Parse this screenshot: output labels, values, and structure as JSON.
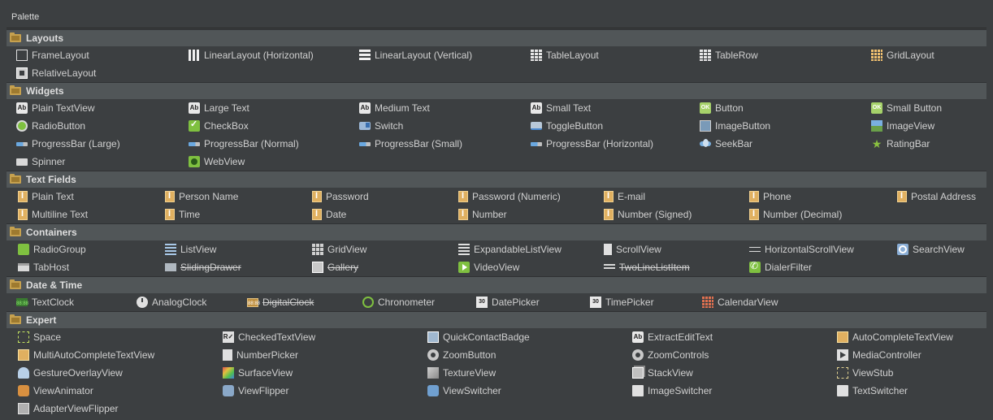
{
  "palette": {
    "title": "Palette"
  },
  "sections": {
    "layouts": {
      "title": "Layouts",
      "items": [
        "FrameLayout",
        "LinearLayout (Horizontal)",
        "LinearLayout (Vertical)",
        "TableLayout",
        "TableRow",
        "GridLayout",
        "RelativeLayout"
      ]
    },
    "widgets": {
      "title": "Widgets",
      "items": [
        "Plain TextView",
        "Large Text",
        "Medium Text",
        "Small Text",
        "Button",
        "Small Button",
        "RadioButton",
        "CheckBox",
        "Switch",
        "ToggleButton",
        "ImageButton",
        "ImageView",
        "ProgressBar (Large)",
        "ProgressBar (Normal)",
        "ProgressBar (Small)",
        "ProgressBar (Horizontal)",
        "SeekBar",
        "RatingBar",
        "Spinner",
        "WebView"
      ]
    },
    "text_fields": {
      "title": "Text Fields",
      "items": [
        "Plain Text",
        "Person Name",
        "Password",
        "Password (Numeric)",
        "E-mail",
        "Phone",
        "Postal Address",
        "Multiline Text",
        "Time",
        "Date",
        "Number",
        "Number (Signed)",
        "Number (Decimal)"
      ]
    },
    "containers": {
      "title": "Containers",
      "items": [
        "RadioGroup",
        "ListView",
        "GridView",
        "ExpandableListView",
        "ScrollView",
        "HorizontalScrollView",
        "SearchView",
        "TabHost",
        "SlidingDrawer",
        "Gallery",
        "VideoView",
        "TwoLineListItem",
        "DialerFilter"
      ]
    },
    "date_time": {
      "title": "Date & Time",
      "items": [
        "TextClock",
        "AnalogClock",
        "DigitalClock",
        "Chronometer",
        "DatePicker",
        "TimePicker",
        "CalendarView"
      ]
    },
    "expert": {
      "title": "Expert",
      "items": [
        "Space",
        "CheckedTextView",
        "QuickContactBadge",
        "ExtractEditText",
        "AutoCompleteTextView",
        "MultiAutoCompleteTextView",
        "NumberPicker",
        "ZoomButton",
        "ZoomControls",
        "MediaController",
        "GestureOverlayView",
        "SurfaceView",
        "TextureView",
        "StackView",
        "ViewStub",
        "ViewAnimator",
        "ViewFlipper",
        "ViewSwitcher",
        "ImageSwitcher",
        "TextSwitcher",
        "AdapterViewFlipper"
      ]
    }
  },
  "icon_glyphs": {
    "ab": "Ab",
    "ok": "OK",
    "star": "★",
    "clock_digits": "88:88",
    "date_digits": "30",
    "checked": "R✓"
  }
}
